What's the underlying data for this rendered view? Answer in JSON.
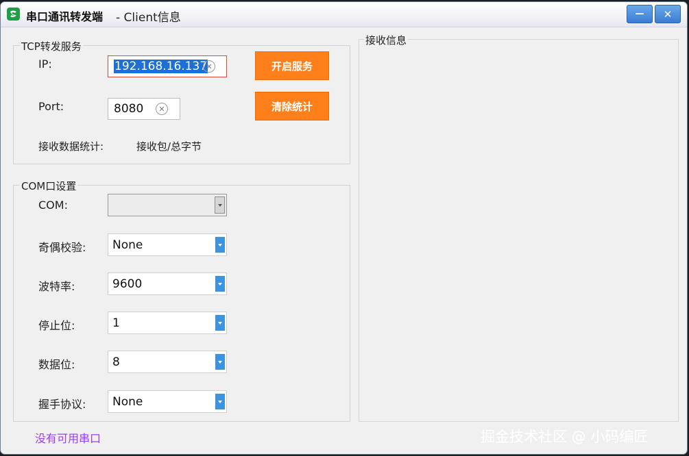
{
  "window": {
    "app_title": "串口通讯转发端",
    "subtitle": "- Client信息",
    "minimize_symbol": "—",
    "close_symbol": "✕"
  },
  "tcp": {
    "group_title": "TCP转发服务",
    "ip_label": "IP:",
    "ip_value": "192.168.16.137",
    "port_label": "Port:",
    "port_value": "8080",
    "start_button": "开启服务",
    "clear_stats_button": "清除统计",
    "stats_label": "接收数据统计:",
    "stats_value": "接收包/总字节"
  },
  "com": {
    "group_title": "COM口设置",
    "com_label": "COM:",
    "com_value": "",
    "parity_label": "奇偶校验:",
    "parity_value": "None",
    "baud_label": "波特率:",
    "baud_value": "9600",
    "stopbits_label": "停止位:",
    "stopbits_value": "1",
    "databits_label": "数据位:",
    "databits_value": "8",
    "handshake_label": "握手协议:",
    "handshake_value": "None"
  },
  "receive": {
    "group_title": "接收信息"
  },
  "status": {
    "message": "没有可用串口"
  },
  "watermark": "掘金技术社区 @ 小码编匠",
  "colors": {
    "accent_orange": "#ff7f1a",
    "dropdown_blue": "#3e93de",
    "status_purple": "#9b3df0",
    "selection_blue": "#1d6fd8"
  }
}
